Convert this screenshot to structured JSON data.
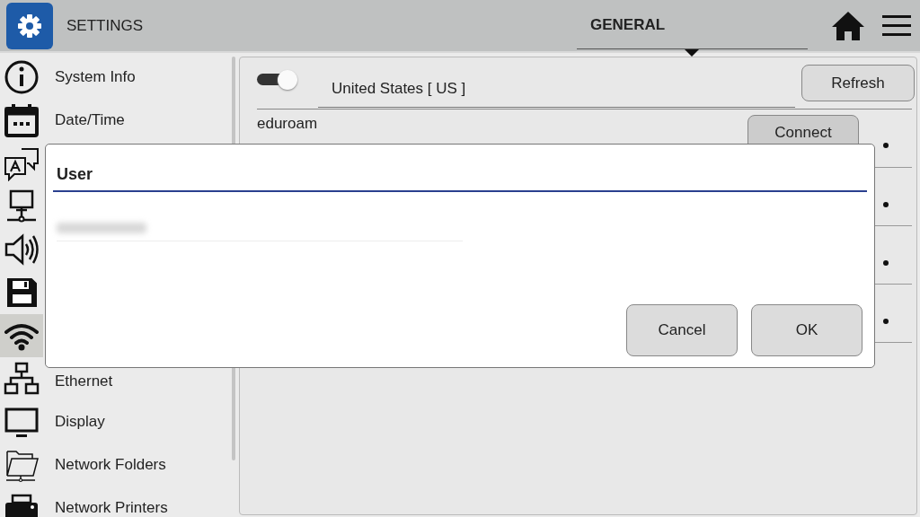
{
  "header": {
    "title": "SETTINGS",
    "tab": {
      "label": "GENERAL",
      "selected": true
    }
  },
  "sidebar": {
    "items": [
      {
        "kind": "info",
        "label": "System Info",
        "selected": false
      },
      {
        "kind": "calendar",
        "label": "Date/Time",
        "selected": false
      },
      {
        "kind": "language",
        "selected": false
      },
      {
        "kind": "network",
        "selected": false
      },
      {
        "kind": "sound",
        "selected": false
      },
      {
        "kind": "save",
        "selected": false
      },
      {
        "kind": "wifi",
        "selected": true
      },
      {
        "kind": "ethernet",
        "label": "Ethernet",
        "selected": false
      },
      {
        "kind": "display",
        "label": "Display",
        "selected": false
      },
      {
        "kind": "folder",
        "label": "Network Folders",
        "selected": false
      },
      {
        "kind": "printer",
        "label": "Network Printers",
        "selected": false
      }
    ]
  },
  "wifi": {
    "enabled": true,
    "country": "United States [ US ]",
    "refresh": "Refresh",
    "networks": [
      {
        "kind": "network",
        "name": "eduroam",
        "action": "Connect"
      },
      {
        "kind": "network"
      },
      {
        "kind": "network"
      },
      {
        "kind": "network"
      }
    ]
  },
  "dialog": {
    "title": "User",
    "buttons": [
      "Cancel",
      "OK"
    ]
  }
}
